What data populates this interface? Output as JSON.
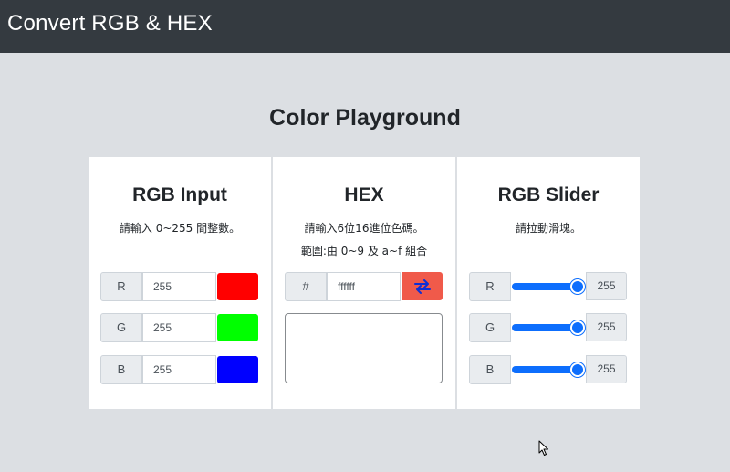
{
  "navbar": {
    "brand": "Convert RGB & HEX"
  },
  "page": {
    "title": "Color Playground"
  },
  "rgb_input": {
    "heading": "RGB Input",
    "description": "請輸入 0~255 間整數。",
    "rows": [
      {
        "label": "R",
        "value": "255",
        "swatch_color": "#ff0000"
      },
      {
        "label": "G",
        "value": "255",
        "swatch_color": "#00ff00"
      },
      {
        "label": "B",
        "value": "255",
        "swatch_color": "#0000ff"
      }
    ]
  },
  "hex": {
    "heading": "HEX",
    "description_line1": "請輸入6位16進位色碼。",
    "description_line2": "範圍:由 0~9 及 a~f 組合",
    "prefix": "#",
    "value": "ffffff",
    "preview_color": "#ffffff",
    "swap_icon": "swap-arrows-icon"
  },
  "rgb_slider": {
    "heading": "RGB Slider",
    "description": "請拉動滑塊。",
    "sliders": [
      {
        "label": "R",
        "value": "255",
        "fraction": 1.0
      },
      {
        "label": "G",
        "value": "255",
        "fraction": 1.0
      },
      {
        "label": "B",
        "value": "255",
        "fraction": 1.0
      }
    ]
  },
  "colors": {
    "navbar_bg": "#343a40",
    "page_bg": "#dcdfe3",
    "accent_blue": "#0d6efd",
    "swap_button": "#f05a4a"
  }
}
